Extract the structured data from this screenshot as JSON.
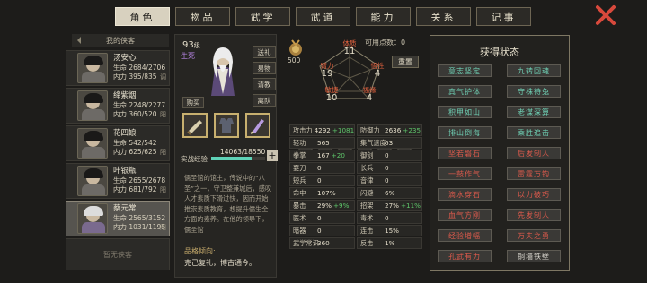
{
  "tabs": [
    "角色",
    "物品",
    "武学",
    "武道",
    "能力",
    "关系",
    "记事"
  ],
  "left_list": {
    "header": "我的侠客",
    "characters": [
      {
        "name": "汤安心",
        "hp": "生命 2684/2706",
        "mp": "内力 395/835",
        "tag": "调"
      },
      {
        "name": "绛紫烟",
        "hp": "生命 2248/2277",
        "mp": "内力 360/520",
        "tag": "阳"
      },
      {
        "name": "花四娘",
        "hp": "生命 542/542",
        "mp": "内力 625/625",
        "tag": "阳"
      },
      {
        "name": "叶银瓶",
        "hp": "生命 2655/2678",
        "mp": "内力 681/792",
        "tag": "阳"
      },
      {
        "name": "蔡元常",
        "hp": "生命 2565/3152",
        "mp": "内力 1031/1195",
        "tag": "阳"
      }
    ],
    "empty_label": "暂无侠客"
  },
  "profile": {
    "level": "93",
    "level_suffix": "级",
    "life_state": "生死",
    "side_buttons": [
      "送礼",
      "易物",
      "请教",
      "离队"
    ],
    "buy_label": "购买",
    "exp_label": "实战经验",
    "exp_value": "14063/18550",
    "exp_progress": 0.758,
    "bio": "儒圣馆的馆主，传说中的“八圣”之一，守卫整兼城后，感叹人才素质下滑过快，因而开始推崇素质教育，想提升儒生全方面的素养。在他的领导下，儒圣馆",
    "bias_label": "品格倾向:",
    "bias_value": "克己复礼，博古通今。"
  },
  "attributes": {
    "free_points": "可用点数：0",
    "reset_label": "重置",
    "points": "500",
    "items": [
      {
        "label": "体质",
        "value": "11"
      },
      {
        "label": "悟性",
        "value": "4"
      },
      {
        "label": "福缘",
        "value": "4"
      },
      {
        "label": "敏捷",
        "value": "10"
      },
      {
        "label": "臂力",
        "value": "19"
      }
    ]
  },
  "stats": [
    [
      {
        "k": "攻击力",
        "v": "4292",
        "b": "+1081"
      },
      {
        "k": "防御力",
        "v": "2636",
        "b": "+235"
      }
    ],
    [
      {
        "k": "轻功",
        "v": "565",
        "b": ""
      },
      {
        "k": "集气速度",
        "v": "63",
        "b": ""
      }
    ],
    [
      {
        "k": "拳掌",
        "v": "167",
        "b": "+20"
      },
      {
        "k": "御剑",
        "v": "0",
        "b": ""
      }
    ],
    [
      {
        "k": "耍刀",
        "v": "0",
        "b": ""
      },
      {
        "k": "长兵",
        "v": "0",
        "b": ""
      }
    ],
    [
      {
        "k": "短兵",
        "v": "0",
        "b": ""
      },
      {
        "k": "音律",
        "v": "0",
        "b": ""
      }
    ],
    [
      {
        "k": "命中",
        "v": "107%",
        "b": ""
      },
      {
        "k": "闪避",
        "v": "6%",
        "b": ""
      }
    ],
    [
      {
        "k": "暴击",
        "v": "29%",
        "b": "+9%"
      },
      {
        "k": "招架",
        "v": "27%",
        "b": "+11%"
      }
    ],
    [
      {
        "k": "医术",
        "v": "0",
        "b": ""
      },
      {
        "k": "毒术",
        "v": "0",
        "b": ""
      }
    ],
    [
      {
        "k": "暗器",
        "v": "0",
        "b": ""
      },
      {
        "k": "连击",
        "v": "15%",
        "b": ""
      }
    ],
    [
      {
        "k": "武学常识",
        "v": "360",
        "b": ""
      },
      {
        "k": "反击",
        "v": "1%",
        "b": ""
      }
    ]
  ],
  "status_panel": {
    "title": "获得状态",
    "items": [
      {
        "label": "意志坚定",
        "color": "#6fd0b4"
      },
      {
        "label": "九转回魂",
        "color": "#6fd0b4"
      },
      {
        "label": "真气护体",
        "color": "#6fd0b4"
      },
      {
        "label": "守株待兔",
        "color": "#6fd0b4"
      },
      {
        "label": "积甲如山",
        "color": "#6fd0b4"
      },
      {
        "label": "老谋深算",
        "color": "#6fd0b4"
      },
      {
        "label": "排山倒海",
        "color": "#6fd0b4"
      },
      {
        "label": "乘胜追击",
        "color": "#6fd0b4"
      },
      {
        "label": "坚若磐石",
        "color": "#de5a4c"
      },
      {
        "label": "后发制人",
        "color": "#de5a4c"
      },
      {
        "label": "一鼓作气",
        "color": "#de5a4c"
      },
      {
        "label": "雷霆万钧",
        "color": "#de5a4c"
      },
      {
        "label": "滴水穿石",
        "color": "#de5a4c"
      },
      {
        "label": "以力破巧",
        "color": "#de5a4c"
      },
      {
        "label": "血气方刚",
        "color": "#de5a4c"
      },
      {
        "label": "先发制人",
        "color": "#de5a4c"
      },
      {
        "label": "经验增幅",
        "color": "#de5a4c"
      },
      {
        "label": "万夫之勇",
        "color": "#de5a4c"
      },
      {
        "label": "孔武有力",
        "color": "#de5a4c"
      },
      {
        "label": "铜墙铁壁",
        "color": "#d7d4cc"
      }
    ]
  }
}
